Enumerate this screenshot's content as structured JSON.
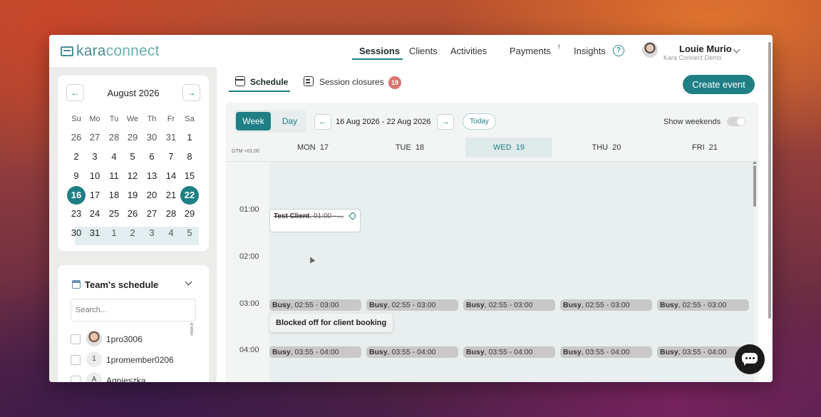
{
  "app": {
    "logo_text_a": "kara",
    "logo_text_b": "connect"
  },
  "nav": {
    "items": [
      "Sessions",
      "Clients",
      "Activities",
      "Payments",
      "Insights"
    ],
    "payments_badge": "!",
    "help_glyph": "?"
  },
  "user": {
    "name": "Louie Murio",
    "org": "Kara Connect Demo"
  },
  "calendar": {
    "prev": "←",
    "next": "→",
    "month": "August 2026",
    "dow": [
      "Su",
      "Mo",
      "Tu",
      "We",
      "Th",
      "Fr",
      "Sa"
    ],
    "weeks": [
      [
        "26",
        "27",
        "28",
        "29",
        "30",
        "31",
        "1"
      ],
      [
        "2",
        "3",
        "4",
        "5",
        "6",
        "7",
        "8"
      ],
      [
        "9",
        "10",
        "11",
        "12",
        "13",
        "14",
        "15"
      ],
      [
        "16",
        "17",
        "18",
        "19",
        "20",
        "21",
        "22"
      ],
      [
        "23",
        "24",
        "25",
        "26",
        "27",
        "28",
        "29"
      ],
      [
        "30",
        "31",
        "1",
        "2",
        "3",
        "4",
        "5"
      ]
    ]
  },
  "team": {
    "title": "Team's schedule",
    "search_placeholder": "Search...",
    "members": [
      {
        "name": "1pro3006",
        "avatar": ""
      },
      {
        "name": "1promember0206",
        "avatar": "1"
      },
      {
        "name": "Agnieszka",
        "avatar": "A"
      }
    ]
  },
  "tabs": {
    "schedule": "Schedule",
    "closures": "Session closures",
    "closures_count": "19"
  },
  "create_event": "Create event",
  "schedule": {
    "view_week": "Week",
    "view_day": "Day",
    "prev": "←",
    "next": "→",
    "range": "16 Aug 2026 - 22 Aug 2026",
    "today": "Today",
    "show_weekends": "Show weekends",
    "timezone": "GTM +01:00",
    "days": [
      {
        "name": "MON",
        "num": "17"
      },
      {
        "name": "TUE",
        "num": "18"
      },
      {
        "name": "WED",
        "num": "19"
      },
      {
        "name": "THU",
        "num": "20"
      },
      {
        "name": "FRI",
        "num": "21"
      }
    ],
    "times": [
      "01:00",
      "02:00",
      "03:00",
      "04:00"
    ],
    "test_event": {
      "client": "Test Client",
      "time": ", 01:00 - ..."
    },
    "busy_label": "Busy",
    "busy_3": ", 02:55 - 03:00",
    "busy_4": ", 03:55 - 04:00",
    "tooltip": "Blocked off for client booking"
  },
  "colors": {
    "accent": "#1e7f85",
    "badge": "#d9756b"
  }
}
